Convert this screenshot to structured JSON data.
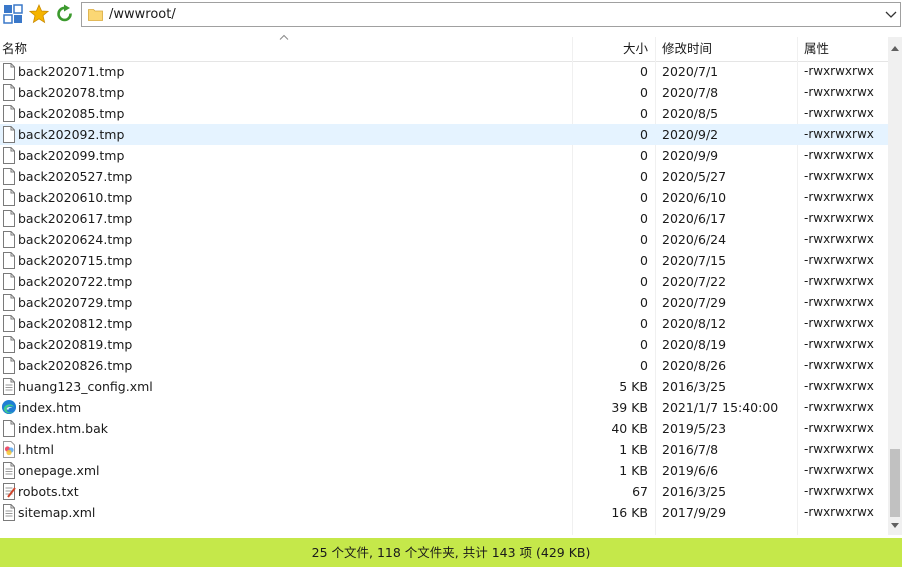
{
  "address": {
    "path": "/wwwroot/"
  },
  "columns": {
    "name": "名称",
    "size": "大小",
    "modified": "修改时间",
    "attributes": "属性"
  },
  "files": [
    {
      "icon": "file-icon",
      "name": "back202071.tmp",
      "size": "0",
      "modified": "2020/7/1",
      "attr": "-rwxrwxrwx"
    },
    {
      "icon": "file-icon",
      "name": "back202078.tmp",
      "size": "0",
      "modified": "2020/7/8",
      "attr": "-rwxrwxrwx"
    },
    {
      "icon": "file-icon",
      "name": "back202085.tmp",
      "size": "0",
      "modified": "2020/8/5",
      "attr": "-rwxrwxrwx"
    },
    {
      "icon": "file-icon",
      "name": "back202092.tmp",
      "size": "0",
      "modified": "2020/9/2",
      "attr": "-rwxrwxrwx",
      "selected": true
    },
    {
      "icon": "file-icon",
      "name": "back202099.tmp",
      "size": "0",
      "modified": "2020/9/9",
      "attr": "-rwxrwxrwx"
    },
    {
      "icon": "file-icon",
      "name": "back2020527.tmp",
      "size": "0",
      "modified": "2020/5/27",
      "attr": "-rwxrwxrwx"
    },
    {
      "icon": "file-icon",
      "name": "back2020610.tmp",
      "size": "0",
      "modified": "2020/6/10",
      "attr": "-rwxrwxrwx"
    },
    {
      "icon": "file-icon",
      "name": "back2020617.tmp",
      "size": "0",
      "modified": "2020/6/17",
      "attr": "-rwxrwxrwx"
    },
    {
      "icon": "file-icon",
      "name": "back2020624.tmp",
      "size": "0",
      "modified": "2020/6/24",
      "attr": "-rwxrwxrwx"
    },
    {
      "icon": "file-icon",
      "name": "back2020715.tmp",
      "size": "0",
      "modified": "2020/7/15",
      "attr": "-rwxrwxrwx"
    },
    {
      "icon": "file-icon",
      "name": "back2020722.tmp",
      "size": "0",
      "modified": "2020/7/22",
      "attr": "-rwxrwxrwx"
    },
    {
      "icon": "file-icon",
      "name": "back2020729.tmp",
      "size": "0",
      "modified": "2020/7/29",
      "attr": "-rwxrwxrwx"
    },
    {
      "icon": "file-icon",
      "name": "back2020812.tmp",
      "size": "0",
      "modified": "2020/8/12",
      "attr": "-rwxrwxrwx"
    },
    {
      "icon": "file-icon",
      "name": "back2020819.tmp",
      "size": "0",
      "modified": "2020/8/19",
      "attr": "-rwxrwxrwx"
    },
    {
      "icon": "file-icon",
      "name": "back2020826.tmp",
      "size": "0",
      "modified": "2020/8/26",
      "attr": "-rwxrwxrwx"
    },
    {
      "icon": "xml-file-icon",
      "name": "huang123_config.xml",
      "size": "5 KB",
      "modified": "2016/3/25",
      "attr": "-rwxrwxrwx"
    },
    {
      "icon": "edge-browser-icon",
      "name": "index.htm",
      "size": "39 KB",
      "modified": "2021/1/7 15:40:00",
      "attr": "-rwxrwxrwx"
    },
    {
      "icon": "file-icon",
      "name": "index.htm.bak",
      "size": "40 KB",
      "modified": "2019/5/23",
      "attr": "-rwxrwxrwx"
    },
    {
      "icon": "html-file-icon",
      "name": "l.html",
      "size": "1 KB",
      "modified": "2016/7/8",
      "attr": "-rwxrwxrwx"
    },
    {
      "icon": "xml-file-icon",
      "name": "onepage.xml",
      "size": "1 KB",
      "modified": "2019/6/6",
      "attr": "-rwxrwxrwx"
    },
    {
      "icon": "text-file-icon",
      "name": "robots.txt",
      "size": "67",
      "modified": "2016/3/25",
      "attr": "-rwxrwxrwx"
    },
    {
      "icon": "xml-file-icon",
      "name": "sitemap.xml",
      "size": "16 KB",
      "modified": "2017/9/29",
      "attr": "-rwxrwxrwx"
    }
  ],
  "status": {
    "summary": "25 个文件, 118 个文件夹, 共计 143 项 (429 KB)"
  },
  "colors": {
    "status_bg": "#c5e84a",
    "selected_row": "#e5f3ff"
  },
  "toolbar": {
    "icons": [
      "view-switch-icon",
      "favorite-star-icon",
      "refresh-icon"
    ]
  }
}
